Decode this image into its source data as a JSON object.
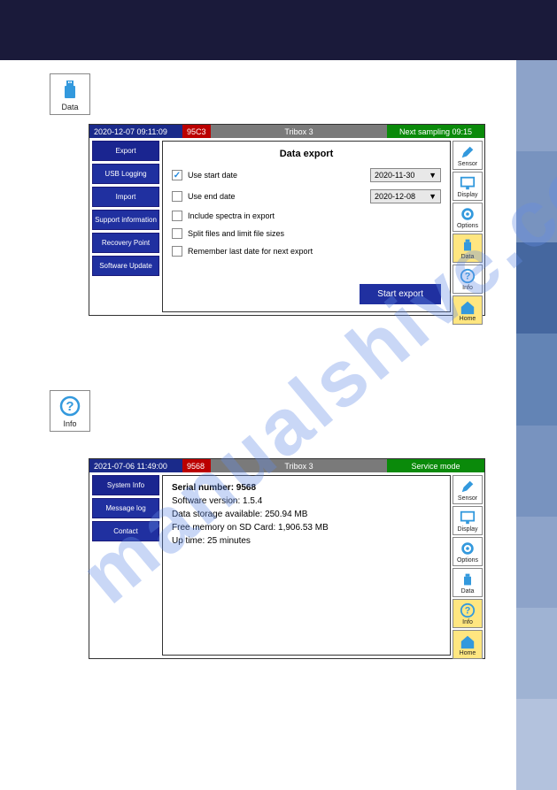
{
  "iconBoxes": {
    "data": "Data",
    "info": "Info"
  },
  "panel1": {
    "timestamp": "2020-12-07 09:11:09",
    "code": "95C3",
    "title": "Tribox 3",
    "right": "Next sampling 09:15",
    "menu": [
      "Export",
      "USB Logging",
      "Import",
      "Support information",
      "Recovery Point",
      "Software Update"
    ],
    "mainTitle": "Data export",
    "rows": {
      "useStart": "Use start date",
      "useEnd": "Use end date",
      "spectra": "Include spectra in export",
      "split": "Split files and limit file sizes",
      "remember": "Remember last date for next export"
    },
    "dates": {
      "start": "2020-11-30",
      "end": "2020-12-08"
    },
    "startBtn": "Start export"
  },
  "panel2": {
    "timestamp": "2021-07-06 11:49:00",
    "code": "9568",
    "title": "Tribox 3",
    "right": "Service mode",
    "menu": [
      "System Info",
      "Message log",
      "Contact"
    ],
    "lines": {
      "serial": "Serial number: 9568",
      "sw": "Software version: 1.5.4",
      "storage": "Data storage available: 250.94 MB",
      "sd": "Free memory on SD Card: 1,906.53 MB",
      "uptime": "Up time: 25 minutes"
    }
  },
  "rightIcons": {
    "sensor": "Sensor",
    "display": "Display",
    "options": "Options",
    "data": "Data",
    "info": "Info",
    "home": "Home"
  },
  "watermark": "manualshive.com"
}
